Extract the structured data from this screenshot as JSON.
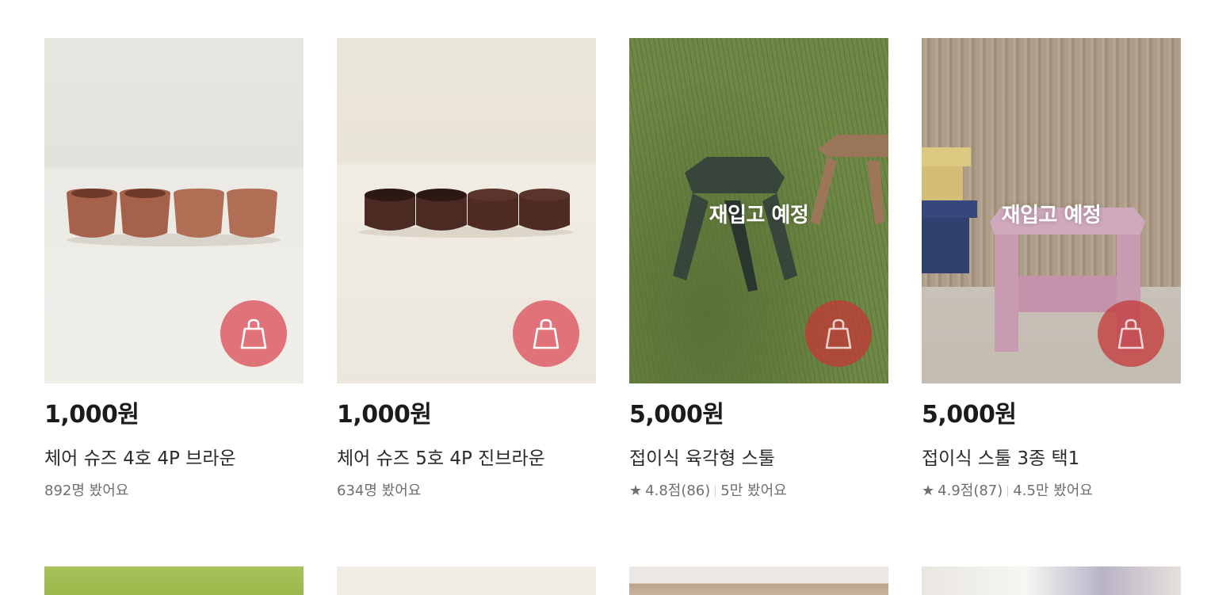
{
  "products": [
    {
      "price": "1,000원",
      "name": "체어 슈즈 4호 4P 브라운",
      "views": "892명 봤어요",
      "image": "chair-shoes-brown",
      "restock": ""
    },
    {
      "price": "1,000원",
      "name": "체어 슈즈 5호 4P 진브라운",
      "views": "634명 봤어요",
      "image": "chair-shoes-dark-brown",
      "restock": ""
    },
    {
      "price": "5,000원",
      "name": "접이식 육각형 스툴",
      "rating": "4.8점(86)",
      "views": "5만 봤어요",
      "image": "hexagon-folding-stool",
      "restock": "재입고 예정"
    },
    {
      "price": "5,000원",
      "name": "접이식 스툴 3종 택1",
      "rating": "4.9점(87)",
      "views": "4.5만 봤어요",
      "image": "folding-stool-3-types",
      "restock": "재입고 예정"
    }
  ],
  "star_glyph": "★",
  "colors": {
    "cart_button": "#e0727a",
    "cart_button_soldout": "#c43737"
  }
}
